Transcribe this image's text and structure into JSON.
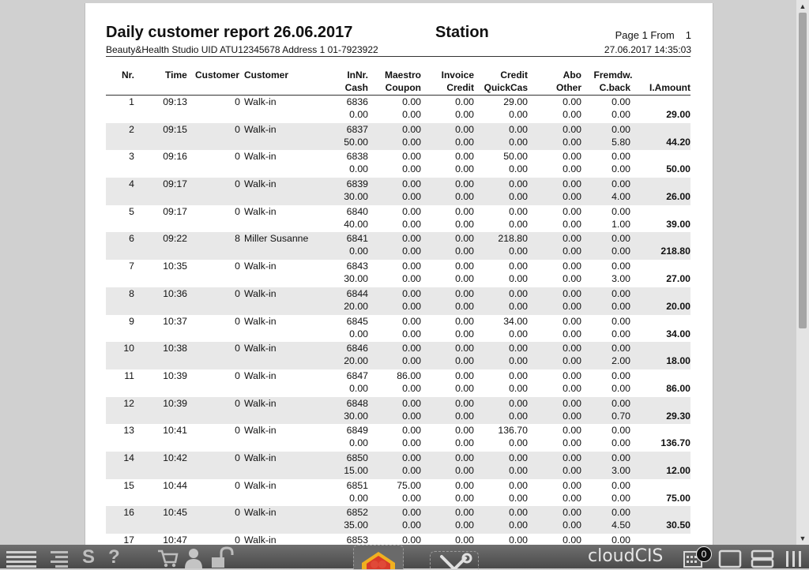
{
  "report": {
    "title": "Daily customer report 26.06.2017",
    "station": "Station",
    "page_label": "Page 1 From",
    "page_total": "1",
    "company_line": "Beauty&Health Studio UID ATU12345678 Address 1 01-7923922",
    "printed_at": "27.06.2017 14:35:03"
  },
  "columns": {
    "nr": "Nr.",
    "time": "Time",
    "customer_no": "Customer",
    "customer": "Customer",
    "innr": "InNr.",
    "cash": "Cash",
    "maestro": "Maestro",
    "coupon": "Coupon",
    "invoice": "Invoice",
    "credit": "Credit",
    "credit2": "Credit",
    "quickcas": "QuickCas",
    "abo": "Abo",
    "other": "Other",
    "fremdw": "Fremdw.",
    "cback": "C.back",
    "amount": "I.Amount"
  },
  "rows": [
    {
      "nr": "1",
      "time": "09:13",
      "cust_no": "0",
      "customer": "Walk-in",
      "innr": "6836",
      "maestro": "0.00",
      "invoice": "0.00",
      "credit": "29.00",
      "abo": "0.00",
      "fremdw": "0.00",
      "cash": "0.00",
      "coupon": "0.00",
      "credit2": "0.00",
      "quickcas": "0.00",
      "other": "0.00",
      "cback": "0.00",
      "amount": "29.00"
    },
    {
      "nr": "2",
      "time": "09:15",
      "cust_no": "0",
      "customer": "Walk-in",
      "innr": "6837",
      "maestro": "0.00",
      "invoice": "0.00",
      "credit": "0.00",
      "abo": "0.00",
      "fremdw": "0.00",
      "cash": "50.00",
      "coupon": "0.00",
      "credit2": "0.00",
      "quickcas": "0.00",
      "other": "0.00",
      "cback": "5.80",
      "amount": "44.20"
    },
    {
      "nr": "3",
      "time": "09:16",
      "cust_no": "0",
      "customer": "Walk-in",
      "innr": "6838",
      "maestro": "0.00",
      "invoice": "0.00",
      "credit": "50.00",
      "abo": "0.00",
      "fremdw": "0.00",
      "cash": "0.00",
      "coupon": "0.00",
      "credit2": "0.00",
      "quickcas": "0.00",
      "other": "0.00",
      "cback": "0.00",
      "amount": "50.00"
    },
    {
      "nr": "4",
      "time": "09:17",
      "cust_no": "0",
      "customer": "Walk-in",
      "innr": "6839",
      "maestro": "0.00",
      "invoice": "0.00",
      "credit": "0.00",
      "abo": "0.00",
      "fremdw": "0.00",
      "cash": "30.00",
      "coupon": "0.00",
      "credit2": "0.00",
      "quickcas": "0.00",
      "other": "0.00",
      "cback": "4.00",
      "amount": "26.00"
    },
    {
      "nr": "5",
      "time": "09:17",
      "cust_no": "0",
      "customer": "Walk-in",
      "innr": "6840",
      "maestro": "0.00",
      "invoice": "0.00",
      "credit": "0.00",
      "abo": "0.00",
      "fremdw": "0.00",
      "cash": "40.00",
      "coupon": "0.00",
      "credit2": "0.00",
      "quickcas": "0.00",
      "other": "0.00",
      "cback": "1.00",
      "amount": "39.00"
    },
    {
      "nr": "6",
      "time": "09:22",
      "cust_no": "8",
      "customer": "Miller Susanne",
      "innr": "6841",
      "maestro": "0.00",
      "invoice": "0.00",
      "credit": "218.80",
      "abo": "0.00",
      "fremdw": "0.00",
      "cash": "0.00",
      "coupon": "0.00",
      "credit2": "0.00",
      "quickcas": "0.00",
      "other": "0.00",
      "cback": "0.00",
      "amount": "218.80"
    },
    {
      "nr": "7",
      "time": "10:35",
      "cust_no": "0",
      "customer": "Walk-in",
      "innr": "6843",
      "maestro": "0.00",
      "invoice": "0.00",
      "credit": "0.00",
      "abo": "0.00",
      "fremdw": "0.00",
      "cash": "30.00",
      "coupon": "0.00",
      "credit2": "0.00",
      "quickcas": "0.00",
      "other": "0.00",
      "cback": "3.00",
      "amount": "27.00"
    },
    {
      "nr": "8",
      "time": "10:36",
      "cust_no": "0",
      "customer": "Walk-in",
      "innr": "6844",
      "maestro": "0.00",
      "invoice": "0.00",
      "credit": "0.00",
      "abo": "0.00",
      "fremdw": "0.00",
      "cash": "20.00",
      "coupon": "0.00",
      "credit2": "0.00",
      "quickcas": "0.00",
      "other": "0.00",
      "cback": "0.00",
      "amount": "20.00"
    },
    {
      "nr": "9",
      "time": "10:37",
      "cust_no": "0",
      "customer": "Walk-in",
      "innr": "6845",
      "maestro": "0.00",
      "invoice": "0.00",
      "credit": "34.00",
      "abo": "0.00",
      "fremdw": "0.00",
      "cash": "0.00",
      "coupon": "0.00",
      "credit2": "0.00",
      "quickcas": "0.00",
      "other": "0.00",
      "cback": "0.00",
      "amount": "34.00"
    },
    {
      "nr": "10",
      "time": "10:38",
      "cust_no": "0",
      "customer": "Walk-in",
      "innr": "6846",
      "maestro": "0.00",
      "invoice": "0.00",
      "credit": "0.00",
      "abo": "0.00",
      "fremdw": "0.00",
      "cash": "20.00",
      "coupon": "0.00",
      "credit2": "0.00",
      "quickcas": "0.00",
      "other": "0.00",
      "cback": "2.00",
      "amount": "18.00"
    },
    {
      "nr": "11",
      "time": "10:39",
      "cust_no": "0",
      "customer": "Walk-in",
      "innr": "6847",
      "maestro": "86.00",
      "invoice": "0.00",
      "credit": "0.00",
      "abo": "0.00",
      "fremdw": "0.00",
      "cash": "0.00",
      "coupon": "0.00",
      "credit2": "0.00",
      "quickcas": "0.00",
      "other": "0.00",
      "cback": "0.00",
      "amount": "86.00"
    },
    {
      "nr": "12",
      "time": "10:39",
      "cust_no": "0",
      "customer": "Walk-in",
      "innr": "6848",
      "maestro": "0.00",
      "invoice": "0.00",
      "credit": "0.00",
      "abo": "0.00",
      "fremdw": "0.00",
      "cash": "30.00",
      "coupon": "0.00",
      "credit2": "0.00",
      "quickcas": "0.00",
      "other": "0.00",
      "cback": "0.70",
      "amount": "29.30"
    },
    {
      "nr": "13",
      "time": "10:41",
      "cust_no": "0",
      "customer": "Walk-in",
      "innr": "6849",
      "maestro": "0.00",
      "invoice": "0.00",
      "credit": "136.70",
      "abo": "0.00",
      "fremdw": "0.00",
      "cash": "0.00",
      "coupon": "0.00",
      "credit2": "0.00",
      "quickcas": "0.00",
      "other": "0.00",
      "cback": "0.00",
      "amount": "136.70"
    },
    {
      "nr": "14",
      "time": "10:42",
      "cust_no": "0",
      "customer": "Walk-in",
      "innr": "6850",
      "maestro": "0.00",
      "invoice": "0.00",
      "credit": "0.00",
      "abo": "0.00",
      "fremdw": "0.00",
      "cash": "15.00",
      "coupon": "0.00",
      "credit2": "0.00",
      "quickcas": "0.00",
      "other": "0.00",
      "cback": "3.00",
      "amount": "12.00"
    },
    {
      "nr": "15",
      "time": "10:44",
      "cust_no": "0",
      "customer": "Walk-in",
      "innr": "6851",
      "maestro": "75.00",
      "invoice": "0.00",
      "credit": "0.00",
      "abo": "0.00",
      "fremdw": "0.00",
      "cash": "0.00",
      "coupon": "0.00",
      "credit2": "0.00",
      "quickcas": "0.00",
      "other": "0.00",
      "cback": "0.00",
      "amount": "75.00"
    },
    {
      "nr": "16",
      "time": "10:45",
      "cust_no": "0",
      "customer": "Walk-in",
      "innr": "6852",
      "maestro": "0.00",
      "invoice": "0.00",
      "credit": "0.00",
      "abo": "0.00",
      "fremdw": "0.00",
      "cash": "35.00",
      "coupon": "0.00",
      "credit2": "0.00",
      "quickcas": "0.00",
      "other": "0.00",
      "cback": "4.50",
      "amount": "30.50"
    },
    {
      "nr": "17",
      "time": "10:47",
      "cust_no": "0",
      "customer": "Walk-in",
      "innr": "6853",
      "maestro": "0.00",
      "invoice": "0.00",
      "credit": "0.00",
      "abo": "0.00",
      "fremdw": "0.00",
      "cash": "",
      "coupon": "",
      "credit2": "",
      "quickcas": "",
      "other": "",
      "cback": "",
      "amount": ""
    }
  ],
  "taskbar": {
    "brand": "cloudCIS",
    "cart_count": "0",
    "icons": [
      "menu-icon",
      "list-icon",
      "s-icon",
      "help-icon",
      "cart-icon",
      "user-icon",
      "unlock-icon",
      "home-logo-icon",
      "tools-icon",
      "calendar-icon",
      "window-icon",
      "layout-rows-icon",
      "layout-columns-icon"
    ],
    "colors": {
      "bar": "#5a5a5a",
      "logo_red": "#d83a2a",
      "logo_gold": "#f0b020"
    }
  }
}
